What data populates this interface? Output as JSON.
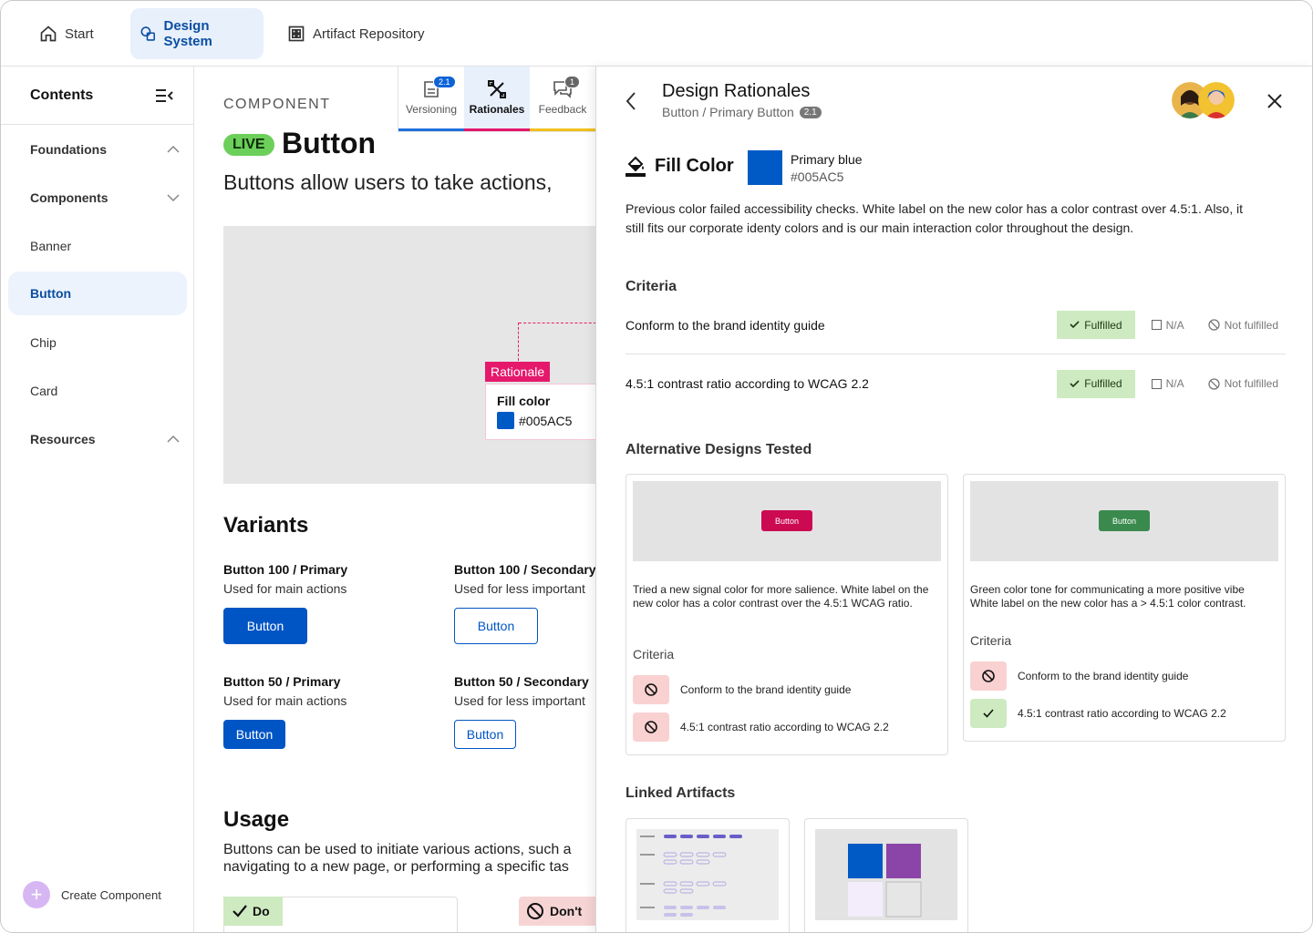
{
  "nav": {
    "start": "Start",
    "design_system": "Design System",
    "artifact_repository": "Artifact Repository"
  },
  "sidebar": {
    "title": "Contents",
    "items": [
      {
        "label": "Foundations"
      },
      {
        "label": "Components"
      },
      {
        "label": "Banner"
      },
      {
        "label": "Button"
      },
      {
        "label": "Chip"
      },
      {
        "label": "Card"
      },
      {
        "label": "Resources"
      }
    ],
    "create": "Create Component"
  },
  "main": {
    "eyebrow": "COMPONENT",
    "status": "LIVE",
    "title": "Button",
    "intro": "Buttons allow users to take actions,",
    "rationale_tag": "Rationale",
    "rationale_label": "Fill color",
    "rationale_value": "#005AC5",
    "variants_heading": "Variants",
    "variants": [
      {
        "title": "Button 100 / Primary",
        "desc": "Used for main actions",
        "button": "Button"
      },
      {
        "title": "Button 100 / Secondary",
        "desc": "Used for less important",
        "button": "Button"
      },
      {
        "title": "Button 50 / Primary",
        "desc": "Used for main actions",
        "button": "Button"
      },
      {
        "title": "Button 50 / Secondary",
        "desc": "Used for less important",
        "button": "Button"
      }
    ],
    "usage_heading": "Usage",
    "usage_line1": "Buttons can be used to initiate various actions, such a",
    "usage_line2": "navigating to a new page, or performing a specific tas",
    "do_label": "Do",
    "dont_label": "Don't"
  },
  "tabs": {
    "versioning": "Versioning",
    "versioning_badge": "2.1",
    "rationales": "Rationales",
    "feedback": "Feedback",
    "feedback_badge": "1"
  },
  "panel": {
    "title": "Design Rationales",
    "breadcrumb": "Button / Primary Button",
    "version": "2.1",
    "fill_title": "Fill Color",
    "swatch_name": "Primary blue",
    "swatch_hex": "#005AC5",
    "description": "Previous color failed accessibility checks. White label on the new color has a color contrast over 4.5:1. Also, it still fits our corporate identy colors and is our main interaction color throughout the design.",
    "criteria_heading": "Criteria",
    "criteria": [
      {
        "label": "Conform to the brand identity guide",
        "fulfilled": "Fulfilled",
        "na": "N/A",
        "not": "Not fulfilled"
      },
      {
        "label": "4.5:1 contrast ratio according to WCAG 2.2",
        "fulfilled": "Fulfilled",
        "na": "N/A",
        "not": "Not fulfilled"
      }
    ],
    "alt_heading": "Alternative Designs Tested",
    "alternatives": [
      {
        "button": "Button",
        "color": "#cc0a52",
        "desc": "Tried a new signal color for more salience. White label on the new color has a color contrast over the 4.5:1 WCAG ratio.",
        "criteria_heading": "Criteria",
        "criteria": [
          {
            "label": "Conform to the brand identity guide",
            "status": "not-fulfilled"
          },
          {
            "label": "4.5:1 contrast ratio according to WCAG 2.2",
            "status": "not-fulfilled"
          }
        ]
      },
      {
        "button": "Button",
        "color": "#3a8a4e",
        "desc": "Green color tone for communicating a more positive vibe White label on the new color has a > 4.5:1 color contrast.",
        "criteria_heading": "Criteria",
        "criteria": [
          {
            "label": "Conform to the brand identity guide",
            "status": "not-fulfilled"
          },
          {
            "label": "4.5:1 contrast ratio according to WCAG 2.2",
            "status": "fulfilled"
          }
        ]
      }
    ],
    "linked_heading": "Linked Artifacts"
  },
  "colors": {
    "primary": "#005AC5",
    "rationale": "#e5186c",
    "fulfilled_bg": "#cdeac0"
  }
}
